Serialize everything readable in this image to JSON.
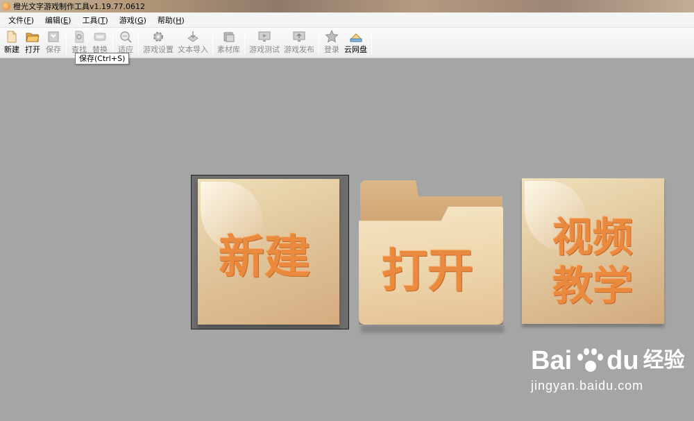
{
  "window": {
    "title": "橙光文字游戏制作工具v1.19.77.0612"
  },
  "menu": [
    {
      "label": "文件",
      "accel": "F"
    },
    {
      "label": "编辑",
      "accel": "E"
    },
    {
      "label": "工具",
      "accel": "T"
    },
    {
      "label": "游戏",
      "accel": "G"
    },
    {
      "label": "帮助",
      "accel": "H"
    }
  ],
  "toolbar": {
    "new": "新建",
    "open": "打开",
    "save": "保存",
    "find": "查找",
    "replace": "替换",
    "fit": "适应",
    "game_settings": "游戏设置",
    "text_import": "文本导入",
    "assets": "素材库",
    "game_test": "游戏测试",
    "game_publish": "游戏发布",
    "login": "登录",
    "cloud": "云网盘"
  },
  "tooltip": "保存(Ctrl+S)",
  "tiles": {
    "new": "新建",
    "open": "打开",
    "video_line1": "视频",
    "video_line2": "教学"
  },
  "watermark": {
    "brand": "Bai",
    "brand_du": "du",
    "cn": "经验",
    "url": "jingyan.baidu.com"
  },
  "colors": {
    "tile_text": "#ea8a3e",
    "background": "#a5a5a5"
  }
}
